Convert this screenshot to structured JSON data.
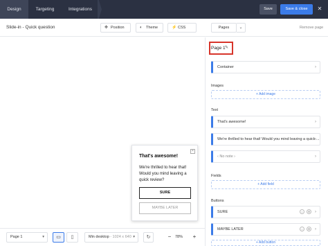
{
  "nav": {
    "tabs": [
      {
        "label": "Design"
      },
      {
        "label": "Targeting"
      },
      {
        "label": "Integrations"
      }
    ],
    "save_label": "Save",
    "save_close_label": "Save & close",
    "close_symbol": "✕"
  },
  "toolbar": {
    "title": "Slide-in - Quick question",
    "position_label": "Position",
    "theme_label": "Theme",
    "css_label": "CSS",
    "pages_label": "Pages",
    "remove_page_label": "Remove page"
  },
  "popup": {
    "title": "That's awesome!",
    "body": "We're thrilled to hear that! Would you mind leaving a quick review?",
    "primary_label": "SURE",
    "secondary_label": "MAYBE LATER"
  },
  "panel": {
    "page_label": "Page 1",
    "container_label": "Container",
    "images_label": "Images",
    "add_image_label": "+ Add image",
    "text_label": "Text",
    "text_items": [
      {
        "label": "That's awesome!"
      },
      {
        "label": "We're thrilled to hear that! Would you mind leaving a quick ..."
      },
      {
        "label": "‹ No note ›"
      }
    ],
    "fields_label": "Fields",
    "add_field_label": "+ Add field",
    "buttons_label": "Buttons",
    "button_items": [
      {
        "label": "SURE"
      },
      {
        "label": "MAYBE LATER"
      }
    ],
    "add_button_label": "+ Add button"
  },
  "bottom": {
    "page_select": "Page 1",
    "min_label": "Min desktop",
    "min_dims": "- 1024 x 640",
    "zoom": "78%",
    "zoom_out": "−",
    "zoom_in": "+"
  },
  "colors": {
    "nav_bg": "#2b3142",
    "accent": "#3b7be8",
    "highlight": "#d7342a"
  },
  "icons": [
    "position-icon",
    "theme-icon",
    "css-icon",
    "edit-icon",
    "desktop-icon",
    "mobile-icon",
    "reset-icon",
    "chevron-right-icon",
    "chevron-down-icon",
    "close-icon"
  ]
}
